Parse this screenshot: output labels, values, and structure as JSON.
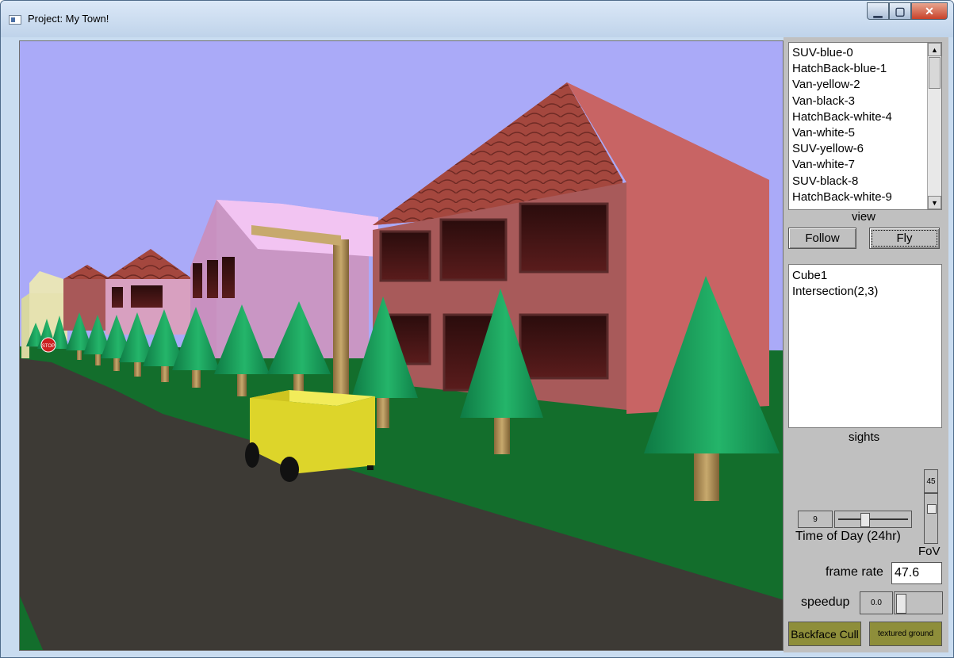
{
  "window": {
    "title": "Project: My Town!",
    "min_glyph": "▁",
    "max_glyph": "▢",
    "close_glyph": "✕",
    "icon": "app-window-icon"
  },
  "scene": {
    "description_icon": "3d-town-view",
    "colors": {
      "sky": "#aaaaf8",
      "grass": "#136e2c",
      "road": "#3d3a35",
      "tree": "#1fa861",
      "cube": "#e0d828"
    },
    "stop_sign_text": "STOP"
  },
  "panel": {
    "vehicles": [
      "SUV-blue-0",
      "HatchBack-blue-1",
      "Van-yellow-2",
      "Van-black-3",
      "HatchBack-white-4",
      "Van-white-5",
      "SUV-yellow-6",
      "Van-white-7",
      "SUV-black-8",
      "HatchBack-white-9"
    ],
    "view_label": "view",
    "follow_label": "Follow",
    "fly_label": "Fly",
    "sights": [
      "Cube1",
      "Intersection(2,3)"
    ],
    "sights_label": "sights",
    "time_value": "9",
    "time_label": "Time of Day (24hr)",
    "fov_value": "45",
    "fov_label": "FoV",
    "frame_rate_label": "frame rate",
    "frame_rate_value": "47.6",
    "speedup_label": "speedup",
    "speedup_value": "0.0",
    "backface_cull_label": "Backface Cull",
    "textured_ground_label": "textured ground"
  }
}
